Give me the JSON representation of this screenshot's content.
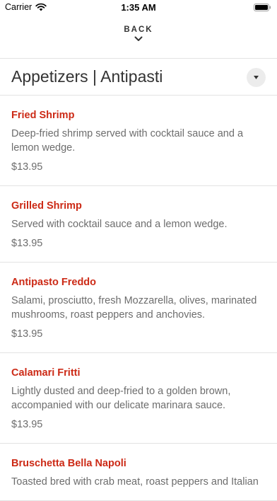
{
  "status_bar": {
    "carrier": "Carrier",
    "time": "1:35 AM"
  },
  "nav": {
    "back_label": "BACK"
  },
  "category": {
    "title": "Appetizers | Antipasti"
  },
  "items": [
    {
      "name": "Fried Shrimp",
      "description": "Deep-fried shrimp served with cocktail sauce and a lemon wedge.",
      "price": "$13.95"
    },
    {
      "name": "Grilled Shrimp",
      "description": "Served with cocktail sauce and a lemon wedge.",
      "price": "$13.95"
    },
    {
      "name": "Antipasto Freddo",
      "description": "Salami, prosciutto, fresh Mozzarella, olives, marinated mushrooms, roast peppers and anchovies.",
      "price": "$13.95"
    },
    {
      "name": "Calamari Fritti",
      "description": "Lightly dusted and deep-fried to a golden brown, accompanied with our delicate marinara sauce.",
      "price": "$13.95"
    },
    {
      "name": "Bruschetta Bella Napoli",
      "description": "Toasted bred with crab meat, roast peppers and Italian",
      "price": ""
    }
  ]
}
